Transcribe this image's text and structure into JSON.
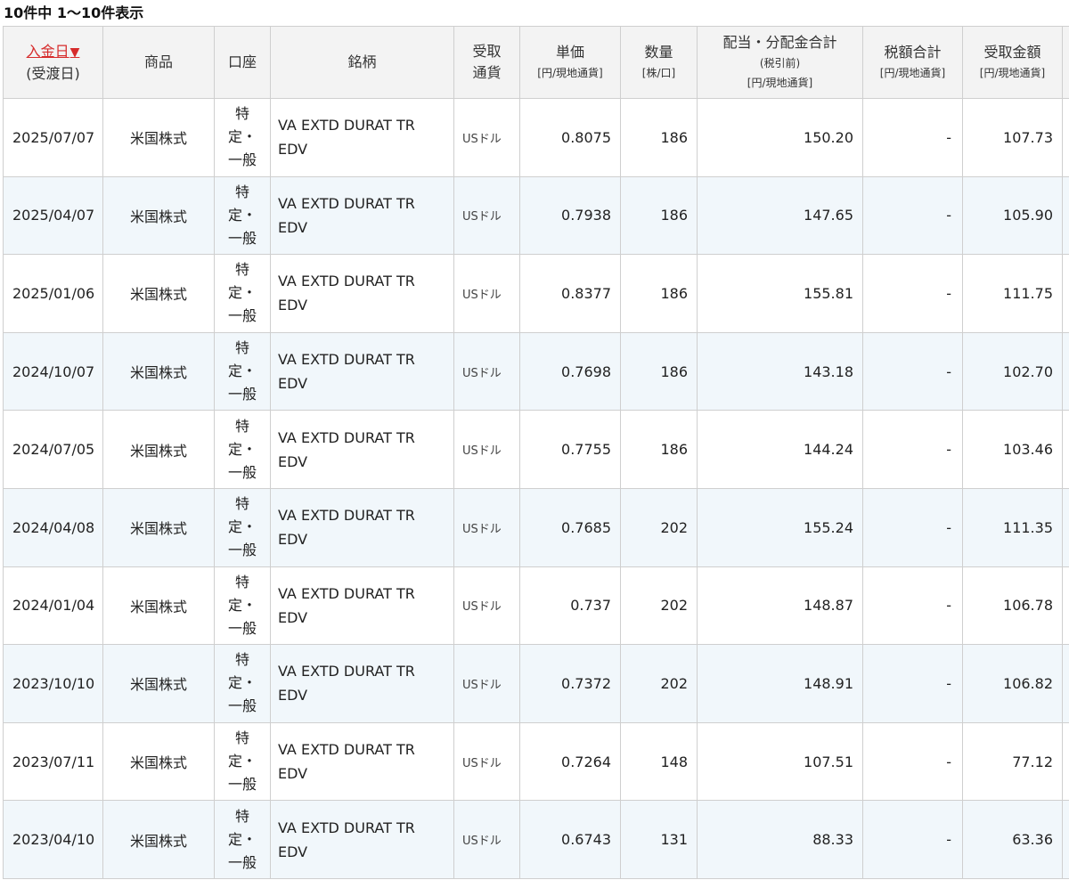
{
  "summary": "10件中 1〜10件表示",
  "headers": {
    "date": {
      "sort_label": "入金日",
      "sort_arrow": "▼",
      "sub": "(受渡日)"
    },
    "product": "商品",
    "account": "口座",
    "name": "銘柄",
    "currency": {
      "line1": "受取",
      "line2": "通貨"
    },
    "unit_price": {
      "main": "単価",
      "sub": "[円/現地通貨]"
    },
    "quantity": {
      "main": "数量",
      "sub": "[株/口]"
    },
    "dividend_total": {
      "main": "配当・分配金合計",
      "sub1": "(税引前)",
      "sub2": "[円/現地通貨]"
    },
    "tax_total": {
      "main": "税額合計",
      "sub": "[円/現地通貨]"
    },
    "received": {
      "main": "受取金額",
      "sub": "[円/現地通貨]"
    }
  },
  "rows": [
    {
      "date": "2025/07/07",
      "product": "米国株式",
      "account": [
        "特",
        "定・",
        "一般"
      ],
      "name": [
        "VA EXTD DURAT TR",
        "EDV"
      ],
      "currency": "USドル",
      "unit_price": "0.8075",
      "quantity": "186",
      "dividend_total": "150.20",
      "tax_total": "-",
      "received": "107.73"
    },
    {
      "date": "2025/04/07",
      "product": "米国株式",
      "account": [
        "特",
        "定・",
        "一般"
      ],
      "name": [
        "VA EXTD DURAT TR",
        "EDV"
      ],
      "currency": "USドル",
      "unit_price": "0.7938",
      "quantity": "186",
      "dividend_total": "147.65",
      "tax_total": "-",
      "received": "105.90"
    },
    {
      "date": "2025/01/06",
      "product": "米国株式",
      "account": [
        "特",
        "定・",
        "一般"
      ],
      "name": [
        "VA EXTD DURAT TR",
        "EDV"
      ],
      "currency": "USドル",
      "unit_price": "0.8377",
      "quantity": "186",
      "dividend_total": "155.81",
      "tax_total": "-",
      "received": "111.75"
    },
    {
      "date": "2024/10/07",
      "product": "米国株式",
      "account": [
        "特",
        "定・",
        "一般"
      ],
      "name": [
        "VA EXTD DURAT TR",
        "EDV"
      ],
      "currency": "USドル",
      "unit_price": "0.7698",
      "quantity": "186",
      "dividend_total": "143.18",
      "tax_total": "-",
      "received": "102.70"
    },
    {
      "date": "2024/07/05",
      "product": "米国株式",
      "account": [
        "特",
        "定・",
        "一般"
      ],
      "name": [
        "VA EXTD DURAT TR",
        "EDV"
      ],
      "currency": "USドル",
      "unit_price": "0.7755",
      "quantity": "186",
      "dividend_total": "144.24",
      "tax_total": "-",
      "received": "103.46"
    },
    {
      "date": "2024/04/08",
      "product": "米国株式",
      "account": [
        "特",
        "定・",
        "一般"
      ],
      "name": [
        "VA EXTD DURAT TR",
        "EDV"
      ],
      "currency": "USドル",
      "unit_price": "0.7685",
      "quantity": "202",
      "dividend_total": "155.24",
      "tax_total": "-",
      "received": "111.35"
    },
    {
      "date": "2024/01/04",
      "product": "米国株式",
      "account": [
        "特",
        "定・",
        "一般"
      ],
      "name": [
        "VA EXTD DURAT TR",
        "EDV"
      ],
      "currency": "USドル",
      "unit_price": "0.737",
      "quantity": "202",
      "dividend_total": "148.87",
      "tax_total": "-",
      "received": "106.78"
    },
    {
      "date": "2023/10/10",
      "product": "米国株式",
      "account": [
        "特",
        "定・",
        "一般"
      ],
      "name": [
        "VA EXTD DURAT TR",
        "EDV"
      ],
      "currency": "USドル",
      "unit_price": "0.7372",
      "quantity": "202",
      "dividend_total": "148.91",
      "tax_total": "-",
      "received": "106.82"
    },
    {
      "date": "2023/07/11",
      "product": "米国株式",
      "account": [
        "特",
        "定・",
        "一般"
      ],
      "name": [
        "VA EXTD DURAT TR",
        "EDV"
      ],
      "currency": "USドル",
      "unit_price": "0.7264",
      "quantity": "148",
      "dividend_total": "107.51",
      "tax_total": "-",
      "received": "77.12"
    },
    {
      "date": "2023/04/10",
      "product": "米国株式",
      "account": [
        "特",
        "定・",
        "一般"
      ],
      "name": [
        "VA EXTD DURAT TR",
        "EDV"
      ],
      "currency": "USドル",
      "unit_price": "0.6743",
      "quantity": "131",
      "dividend_total": "88.33",
      "tax_total": "-",
      "received": "63.36"
    }
  ]
}
